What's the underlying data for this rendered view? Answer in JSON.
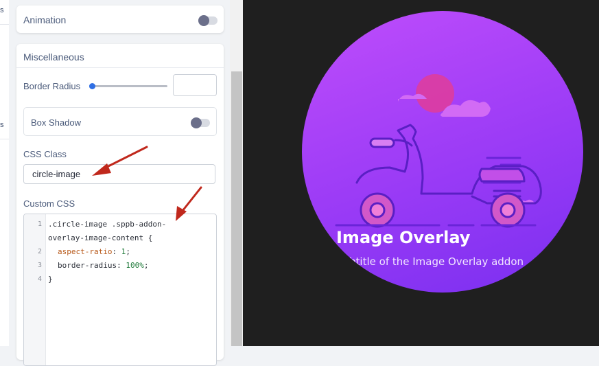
{
  "left_strip": {
    "fragments": [
      "s",
      "s"
    ]
  },
  "animation": {
    "title": "Animation",
    "toggle_on": false
  },
  "misc": {
    "title": "Miscellaneous",
    "border_radius_label": "Border Radius",
    "border_radius_value": 0,
    "box_shadow_label": "Box Shadow",
    "box_shadow_on": false,
    "css_class_label": "CSS Class",
    "css_class_value": "circle-image",
    "custom_css_label": "Custom CSS",
    "code_line_numbers": [
      "1",
      "2",
      "3",
      "4"
    ],
    "code_lines": {
      "l1a": ".circle-image .sppb-addon-",
      "l1b": "overlay-image-content {",
      "l2_prop": "aspect-ratio",
      "l2_colon": ": ",
      "l2_val": "1",
      "l2_end": ";",
      "l3_prop": "border-radius",
      "l3_colon": ": ",
      "l3_val": "100%",
      "l3_end": ";",
      "l4": "}"
    }
  },
  "preview": {
    "title": "Image Overlay",
    "subtitle": "Subtitle of the Image Overlay addon"
  },
  "colors": {
    "accent": "#2f6fe4",
    "annotation_arrow": "#c0281c",
    "overlay_gradient_start": "#bf4dfb",
    "overlay_gradient_end": "#7a2ff0"
  }
}
